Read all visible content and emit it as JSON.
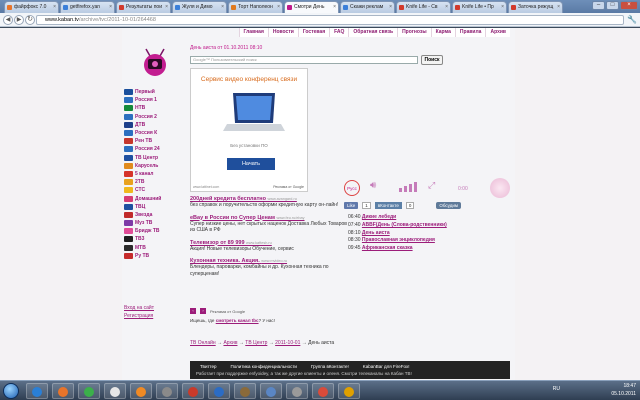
{
  "browser": {
    "tabs": [
      {
        "title": "файрфокс 7.0",
        "color": "#e8742a"
      },
      {
        "title": "getfirefox.yan",
        "color": "#3b7fd9"
      },
      {
        "title": "Результаты пои",
        "color": "#d23a2c"
      },
      {
        "title": "Жуля и Димо",
        "color": "#3b7fd9"
      },
      {
        "title": "Торт Наполеон",
        "color": "#e07a1f"
      },
      {
        "title": "Смотри День",
        "color": "#c0188a"
      },
      {
        "title": "Скажи реклам",
        "color": "#3b7fd9"
      },
      {
        "title": "Knife Life - Св",
        "color": "#d23a2c"
      },
      {
        "title": "Knife Life • Пр",
        "color": "#d23a2c"
      },
      {
        "title": "Заточка режущ",
        "color": "#d23a2c"
      }
    ],
    "active_tab": 5,
    "url_domain": "www.kaban.tv",
    "url_path": "/archive/tvc/2011-10-01/264468"
  },
  "site": {
    "nav": [
      "Главная",
      "Новости",
      "Гостевая",
      "FAQ",
      "Обратная связь",
      "Прогнозы",
      "Карма",
      "Правила",
      "Архив"
    ],
    "title": "День аиста от 01.10.2011 08:10",
    "search_placeholder": "Google™ Пользовательский поиск",
    "search_button": "Поиск"
  },
  "channels": [
    {
      "name": "Первый",
      "color": "#1a4f9c"
    },
    {
      "name": "Россия 1",
      "color": "#2c6fbf"
    },
    {
      "name": "НТВ",
      "color": "#148a3a"
    },
    {
      "name": "Россия 2",
      "color": "#2c6fbf"
    },
    {
      "name": "ДТВ",
      "color": "#1d3f8a"
    },
    {
      "name": "Россия К",
      "color": "#2c6fbf"
    },
    {
      "name": "Рен ТВ",
      "color": "#c6372c"
    },
    {
      "name": "Россия 24",
      "color": "#2c6fbf"
    },
    {
      "name": "ТВ Центр",
      "color": "#1e50a0"
    },
    {
      "name": "Карусель",
      "color": "#e08b1e"
    },
    {
      "name": "5 канал",
      "color": "#d5332a"
    },
    {
      "name": "2ТВ",
      "color": "#e8a21f"
    },
    {
      "name": "СТС",
      "color": "#f0b81e"
    },
    {
      "name": "Домашний",
      "color": "#d63c73"
    },
    {
      "name": "ТВЦ",
      "color": "#1e50a0"
    },
    {
      "name": "Звезда",
      "color": "#c02a2a"
    },
    {
      "name": "Муз ТВ",
      "color": "#7d3aa6"
    },
    {
      "name": "Бридж ТВ",
      "color": "#e04c97"
    },
    {
      "name": "ТВ3",
      "color": "#1e1e1e"
    },
    {
      "name": "МТВ",
      "color": "#2b2b2b"
    },
    {
      "name": "Ру ТВ",
      "color": "#c52b2b"
    }
  ],
  "side_links": [
    "Вход на сайт",
    "Регистрация"
  ],
  "ad_banner": {
    "headline": "Сервис видео конференц связи",
    "subtitle": "Без установки ПО",
    "button": "Начать",
    "url": "www.lattinet.com",
    "attribution": "Реклама от Google"
  },
  "text_ads": [
    {
      "title": "200дней кредита бесплатно",
      "domain": "www.avangard.ru",
      "desc": "без справок и поручительств оформи кредитную карту он-лайн!"
    },
    {
      "title": "eBay в России по Супер Ценам",
      "domain": "www.feu.ru/ebay",
      "desc": "Супер низкие цены, нет скрытых наценок Доставка Любых Товаров из США в РФ"
    },
    {
      "title": "Телевизор от 89 999",
      "domain": "www.kaftesh.ru",
      "desc": "Акция! Новые телевизоры Обучение, сервис"
    },
    {
      "title": "Кухонная техника. Акция.",
      "domain": "www.mvideo.ru",
      "desc": "Блендеры, пароварки, комбайны и др. Кухонная техника по суперценам!"
    }
  ],
  "ads_attribution": "Реклама от Google",
  "question_prefix": "Ищешь, где",
  "question_link": "смотреть канал tbc",
  "question_suffix": "? У нас!",
  "player": {
    "rus_label": "Русс",
    "timer": "0:00"
  },
  "social": {
    "fb_like": "Like",
    "fb_count": "1",
    "vk_label": "вКонтакте",
    "vk_count": "0",
    "discuss": "Обсудим"
  },
  "schedule": [
    {
      "time": "06:40",
      "show": "Дикие лебеди"
    },
    {
      "time": "07:40",
      "show": "ABBF(День (Слова-родственники)"
    },
    {
      "time": "08:10",
      "show": "День аиста"
    },
    {
      "time": "08:30",
      "show": "Православная энциклопедия"
    },
    {
      "time": "09:45",
      "show": "Африканская сказка"
    }
  ],
  "breadcrumb": [
    "ТВ Онлайн",
    "Архив",
    "ТВ Центр",
    "2011-10-01",
    "День аиста"
  ],
  "footer": {
    "links": [
      "Твиттер",
      "Политика конфиденциальности",
      "Группа вКонтакте!",
      "KabanBar для FireFox!"
    ],
    "note": "Работает при поддержке enfyoidey, а так же другие клиенты и оленя. Смотри телеканалы на Кабан ТВ!"
  },
  "taskbar": {
    "lang": "RU",
    "time": "18:47",
    "date": "05.10.2011",
    "apps": [
      "#2a7fd6",
      "#e8742a",
      "#3bb04a",
      "#e7e7e7",
      "#f08a24",
      "#8a8a8a",
      "#c93a2a",
      "#2b6cc4",
      "#8a6a3a",
      "#5a86c4",
      "#9a9a9a",
      "#d94b3a",
      "#e0a000"
    ]
  }
}
